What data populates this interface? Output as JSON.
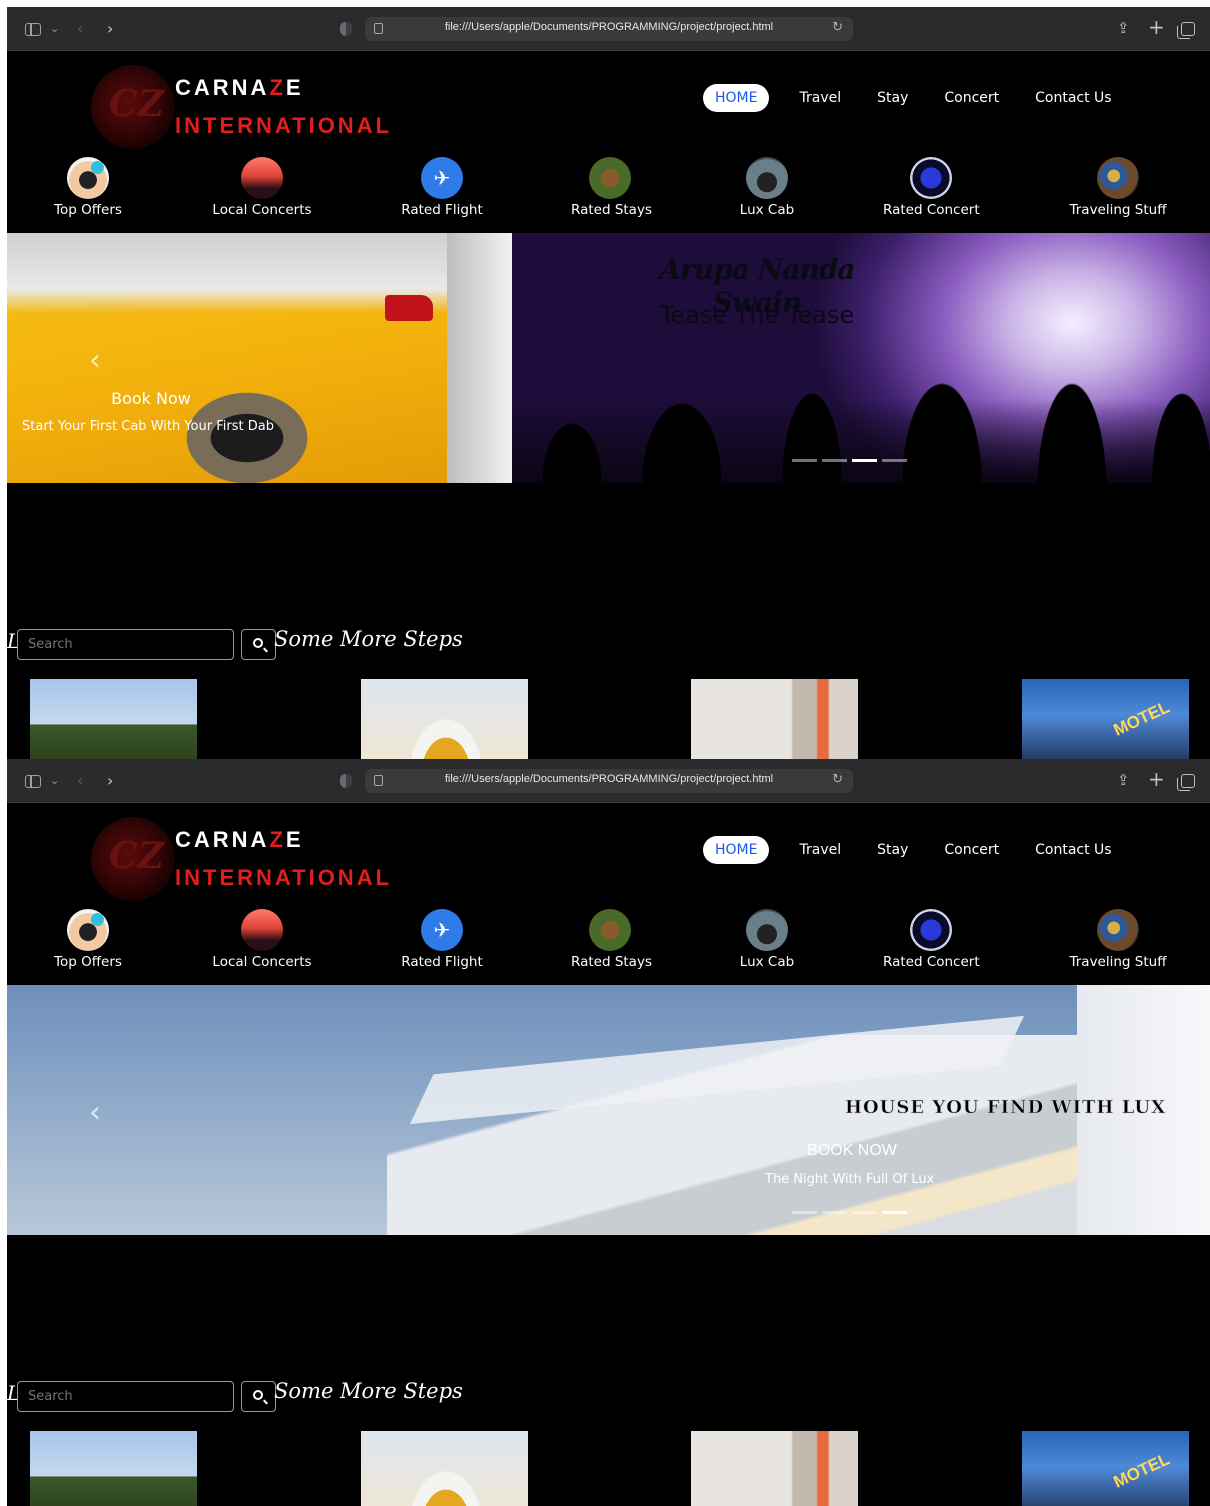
{
  "browser": {
    "url": "file:///Users/apple/Documents/PROGRAMMING/project/project.html"
  },
  "logo": {
    "line1_a": "CARNA",
    "line1_z": "Z",
    "line1_b": "E",
    "line2": "INTERNATIONAL"
  },
  "nav": {
    "items": [
      "HOME",
      "Travel",
      "Stay",
      "Concert",
      "Contact Us"
    ],
    "active_color": "#1a5adf"
  },
  "categories": [
    {
      "label": "Top Offers",
      "icon": "offers-icon"
    },
    {
      "label": "Local Concerts",
      "icon": "local-concerts-icon"
    },
    {
      "label": "Rated Flight",
      "icon": "airplane-icon"
    },
    {
      "label": "Rated Stays",
      "icon": "stays-icon"
    },
    {
      "label": "Lux Cab",
      "icon": "cab-icon"
    },
    {
      "label": "Rated Concert",
      "icon": "concert-icon"
    },
    {
      "label": "Traveling Stuff",
      "icon": "traveling-stuff-icon"
    }
  ],
  "slides": {
    "taxi": {
      "title": "Book Now",
      "text": "Start Your First Cab With Your First Dab"
    },
    "concert": {
      "title": "Arupa Nanda Swain",
      "subtitle": "Tease The Tease"
    },
    "house": {
      "title": "HOUSE YOU FIND WITH LUX",
      "caption_title": "BOOK NOW",
      "caption_text": "The Night With Full Of Lux"
    }
  },
  "search": {
    "placeholder": "Search",
    "prefix": "L",
    "steps_title": "Some More Steps"
  },
  "thumbs": {
    "motel_sign": "MOTEL"
  },
  "colors": {
    "brand_red": "#e01e1e",
    "background": "#000000"
  }
}
